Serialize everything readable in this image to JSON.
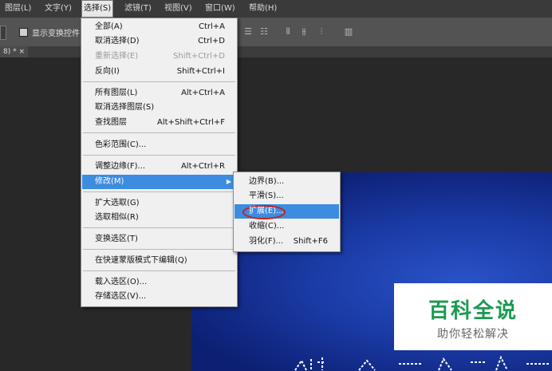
{
  "menubar": {
    "items": [
      "图层(L)",
      "文字(Y)",
      "选择(S)",
      "滤镜(T)",
      "视图(V)",
      "窗口(W)",
      "帮助(H)"
    ]
  },
  "options": {
    "show_transform": "显示变换控件"
  },
  "tab": {
    "label": "8) * ×"
  },
  "select_menu": {
    "items": [
      {
        "label": "全部(A)",
        "shortcut": "Ctrl+A"
      },
      {
        "label": "取消选择(D)",
        "shortcut": "Ctrl+D"
      },
      {
        "label": "重新选择(E)",
        "shortcut": "Shift+Ctrl+D",
        "disabled": true
      },
      {
        "label": "反向(I)",
        "shortcut": "Shift+Ctrl+I"
      },
      {
        "label": "所有图层(L)",
        "shortcut": "Alt+Ctrl+A"
      },
      {
        "label": "取消选择图层(S)",
        "shortcut": ""
      },
      {
        "label": "查找图层",
        "shortcut": "Alt+Shift+Ctrl+F"
      },
      {
        "label": "色彩范围(C)...",
        "shortcut": ""
      },
      {
        "label": "调整边缘(F)...",
        "shortcut": "Alt+Ctrl+R"
      },
      {
        "label": "修改(M)",
        "shortcut": "",
        "highlighted": true,
        "submenu": true
      },
      {
        "label": "扩大选取(G)",
        "shortcut": ""
      },
      {
        "label": "选取相似(R)",
        "shortcut": ""
      },
      {
        "label": "变换选区(T)",
        "shortcut": ""
      },
      {
        "label": "在快速蒙版模式下编辑(Q)",
        "shortcut": ""
      },
      {
        "label": "载入选区(O)...",
        "shortcut": ""
      },
      {
        "label": "存储选区(V)...",
        "shortcut": ""
      }
    ]
  },
  "modify_menu": {
    "items": [
      {
        "label": "边界(B)...",
        "shortcut": ""
      },
      {
        "label": "平滑(S)...",
        "shortcut": ""
      },
      {
        "label": "扩展(E)...",
        "shortcut": "",
        "highlighted": true
      },
      {
        "label": "收缩(C)...",
        "shortcut": ""
      },
      {
        "label": "羽化(F)...",
        "shortcut": "Shift+F6"
      }
    ]
  },
  "watermark": {
    "title": "百科全说",
    "subtitle": "助你轻松解决"
  },
  "colors": {
    "highlight": "#3c8ce0",
    "canvas_blue": "#1a3aa4",
    "annotation_red": "#c8201c",
    "watermark_green": "#1a9a50"
  }
}
